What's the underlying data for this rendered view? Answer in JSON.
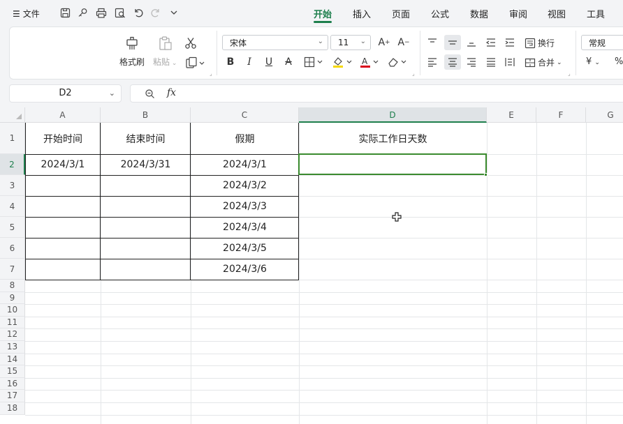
{
  "topbar": {
    "menu_label": "文件",
    "tabs": [
      {
        "label": "开始"
      },
      {
        "label": "插入"
      },
      {
        "label": "页面"
      },
      {
        "label": "公式"
      },
      {
        "label": "数据"
      },
      {
        "label": "审阅"
      },
      {
        "label": "视图"
      },
      {
        "label": "工具"
      }
    ]
  },
  "ribbon": {
    "format_painter": "格式刷",
    "paste": "粘贴",
    "font_name": "宋体",
    "font_size": "11",
    "wrap_text": "换行",
    "merge": "合并",
    "number_format": "常规",
    "currency_symbol": "¥"
  },
  "formula_bar": {
    "name_box": "D2",
    "fx_label": "fx",
    "value": ""
  },
  "sheet": {
    "columns": [
      "A",
      "B",
      "C",
      "D",
      "E",
      "F",
      "G"
    ],
    "selected_column": "D",
    "selected_row": "2",
    "rows": [
      "1",
      "2",
      "3",
      "4",
      "5",
      "6",
      "7",
      "8",
      "9",
      "10",
      "11",
      "12",
      "13",
      "14",
      "15",
      "16",
      "17",
      "18"
    ],
    "cells": {
      "A1": "开始时间",
      "B1": "结束时间",
      "C1": "假期",
      "D1": "实际工作日天数",
      "A2": "2024/3/1",
      "B2": "2024/3/31",
      "C2": "2024/3/1",
      "C3": "2024/3/2",
      "C4": "2024/3/3",
      "C5": "2024/3/4",
      "C6": "2024/3/5",
      "C7": "2024/3/6"
    }
  },
  "colors": {
    "accent": "#1e7f4d",
    "selection": "#3a8a2e",
    "highlight_yellow": "#f5d800",
    "font_red": "#d9001b"
  }
}
